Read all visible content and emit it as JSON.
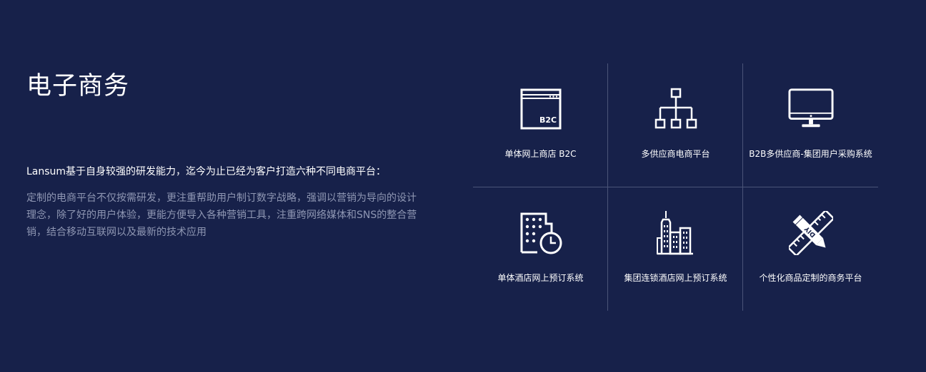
{
  "section": {
    "title": "电子商务",
    "lead": "Lansum基于自身较强的研发能力，迄今为止已经为客户打造六种不同电商平台：",
    "description": "定制的电商平台不仅按需研发，更注重帮助用户制订数字战略，强调以营销为导向的设计理念，除了好的用户体验，更能方便导入各种营销工具，注重跨网络媒体和SNS的整合营销，结合移动互联网以及最新的技术应用"
  },
  "platforms": [
    {
      "label": "单体网上商店 B2C",
      "icon": "browser-b2c-icon",
      "icon_text": "B2C"
    },
    {
      "label": "多供应商电商平台",
      "icon": "hierarchy-icon"
    },
    {
      "label": "B2B多供应商-集团用户采购系统",
      "icon": "monitor-icon"
    },
    {
      "label": "单体酒店网上预订系统",
      "icon": "building-clock-icon"
    },
    {
      "label": "集团连锁酒店网上预订系统",
      "icon": "city-buildings-icon"
    },
    {
      "label": "个性化商品定制的商务平台",
      "icon": "diy-pencil-ruler-icon",
      "icon_text": "DIY"
    }
  ],
  "colors": {
    "background": "#17214a",
    "text": "#ffffff",
    "muted_text": "#8f97b3",
    "divider": "#4b5478"
  }
}
